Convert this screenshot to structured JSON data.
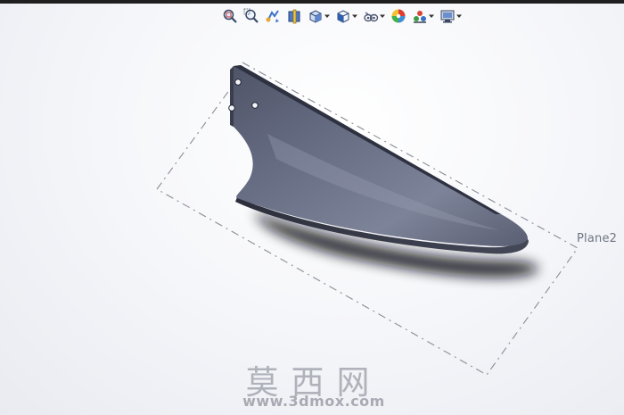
{
  "toolbar": {
    "items": [
      {
        "icon": "zoom-to-fit-icon",
        "dropdown": false
      },
      {
        "icon": "zoom-to-area-icon",
        "dropdown": false
      },
      {
        "icon": "previous-view-icon",
        "dropdown": false
      },
      {
        "icon": "section-view-icon",
        "dropdown": false
      },
      {
        "icon": "view-orientation-icon",
        "dropdown": true
      },
      {
        "icon": "display-style-icon",
        "dropdown": true
      },
      {
        "icon": "hide-show-items-icon",
        "dropdown": true
      },
      {
        "icon": "edit-appearance-icon",
        "dropdown": false
      },
      {
        "icon": "apply-scene-icon",
        "dropdown": true
      },
      {
        "icon": "view-settings-icon",
        "dropdown": true
      }
    ]
  },
  "viewport": {
    "plane_label": "Plane2",
    "part_color": "#5c6276",
    "plane_line_color": "#8a8d95"
  },
  "watermark": {
    "site_cn": "莫西网",
    "url": "www.3dmox.com"
  }
}
